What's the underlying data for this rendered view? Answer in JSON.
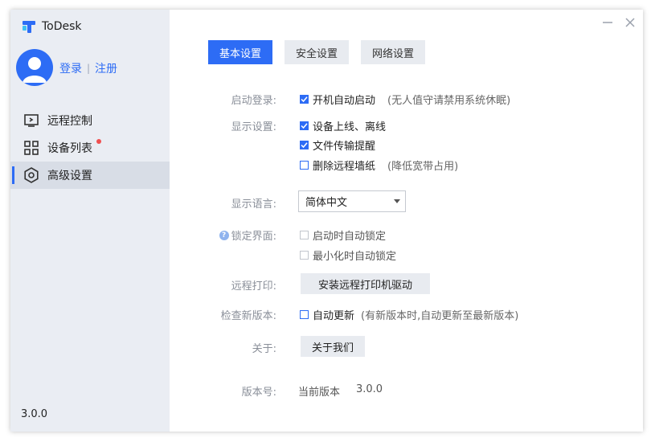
{
  "app": {
    "name": "ToDesk",
    "version": "3.0.0"
  },
  "auth": {
    "login": "登录",
    "separator": "|",
    "register": "注册"
  },
  "nav": [
    {
      "label": "远程控制",
      "icon": "remote-control-icon"
    },
    {
      "label": "设备列表",
      "icon": "device-list-icon",
      "badge": true
    },
    {
      "label": "高级设置",
      "icon": "settings-gear-icon",
      "active": true
    }
  ],
  "window": {
    "minimize": "—",
    "close": "✕"
  },
  "tabs": [
    {
      "label": "基本设置",
      "active": true
    },
    {
      "label": "安全设置"
    },
    {
      "label": "网络设置"
    }
  ],
  "settings": {
    "startup": {
      "label": "启动登录:",
      "option": "开机自动启动",
      "checked": true,
      "hint": "(无人值守请禁用系统休眠)"
    },
    "display": {
      "label": "显示设置:",
      "options": [
        {
          "text": "设备上线、离线",
          "checked": true
        },
        {
          "text": "文件传输提醒",
          "checked": true
        },
        {
          "text": "删除远程墙纸",
          "checked": false,
          "hint": "(降低宽带占用)"
        }
      ]
    },
    "language": {
      "label": "显示语言:",
      "value": "简体中文"
    },
    "lock": {
      "label": "锁定界面:",
      "help": "?",
      "options": [
        {
          "text": "启动时自动锁定",
          "checked": false
        },
        {
          "text": "最小化时自动锁定",
          "checked": false
        }
      ]
    },
    "print": {
      "label": "远程打印:",
      "button": "安装远程打印机驱动"
    },
    "update": {
      "label": "检查新版本:",
      "option": "自动更新",
      "checked": false,
      "hint": "(有新版本时,自动更新至最新版本)"
    },
    "about": {
      "label": "关于:",
      "button": "关于我们"
    },
    "version": {
      "label": "版本号:",
      "current_label": "当前版本",
      "value": "3.0.0"
    }
  },
  "colors": {
    "accent": "#2d6cf5",
    "sidebar": "#eaedf3",
    "badge": "#f05050"
  }
}
